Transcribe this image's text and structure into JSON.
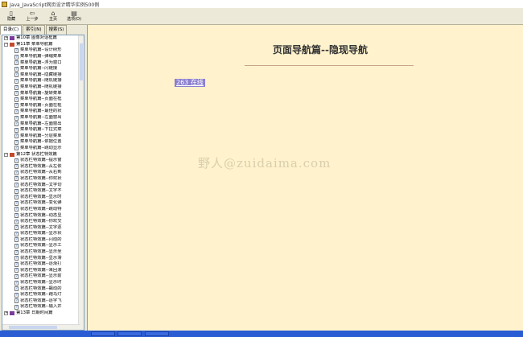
{
  "window": {
    "title": "Java_JavaScript网页设计精华实例500例"
  },
  "toolbar": [
    {
      "icon": "hide-icon",
      "glyph": "▯",
      "label": "隐藏"
    },
    {
      "icon": "back-icon",
      "glyph": "⇦",
      "label": "上一步"
    },
    {
      "icon": "home-icon",
      "glyph": "⌂",
      "label": "主页"
    },
    {
      "icon": "options-icon",
      "glyph": "▤",
      "label": "选项(O)"
    }
  ],
  "tabs": [
    {
      "label": "目录(C)",
      "active": true
    },
    {
      "label": "索引(N)",
      "active": false
    },
    {
      "label": "搜索(S)",
      "active": false
    }
  ],
  "tree": [
    {
      "type": "chapter",
      "expanded": false,
      "label": "第10章 图像对话框篇"
    },
    {
      "type": "chapter",
      "expanded": true,
      "label": "第11章 菜单导航篇"
    },
    {
      "type": "page",
      "label": "菜单导航篇--设计树形"
    },
    {
      "type": "page",
      "label": "菜单导航篇--弹缩菜单"
    },
    {
      "type": "page",
      "label": "菜单导航篇--浮为窗口"
    },
    {
      "type": "page",
      "label": "菜单导航篇--闪链接"
    },
    {
      "type": "page",
      "label": "菜单导航篇--隐藏链接"
    },
    {
      "type": "page",
      "label": "菜单导航篇--随机链接"
    },
    {
      "type": "page",
      "label": "菜单导航篇--随机链接"
    },
    {
      "type": "page",
      "label": "菜单导航篇--旋转菜单"
    },
    {
      "type": "page",
      "label": "菜单导航篇--页面在框"
    },
    {
      "type": "page",
      "label": "菜单导航篇--页面在框"
    },
    {
      "type": "page",
      "label": "菜单导航篇--最佳的状"
    },
    {
      "type": "page",
      "label": "菜单导航篇--左面窗出"
    },
    {
      "type": "page",
      "label": "菜单导航篇--左面窗出"
    },
    {
      "type": "page",
      "label": "菜单导航篇--下拉式菜"
    },
    {
      "type": "page",
      "label": "菜单导航篇--分层菜单"
    },
    {
      "type": "page",
      "label": "菜单导航篇--依据位置"
    },
    {
      "type": "page",
      "label": "菜单导航篇--跳动显示"
    },
    {
      "type": "chapter",
      "expanded": true,
      "label": "第12章 状态栏特效篇"
    },
    {
      "type": "page",
      "label": "状态栏特效篇--提示窗"
    },
    {
      "type": "page",
      "label": "状态栏特效篇--从左依"
    },
    {
      "type": "page",
      "label": "状态栏特效篇--从右到"
    },
    {
      "type": "page",
      "label": "状态栏特效篇--你欢状"
    },
    {
      "type": "page",
      "label": "状态栏特效篇--文字切"
    },
    {
      "type": "page",
      "label": "状态栏特效篇--文字不"
    },
    {
      "type": "page",
      "label": "状态栏特效篇--显示时"
    },
    {
      "type": "page",
      "label": "状态栏特效篇--变化弹"
    },
    {
      "type": "page",
      "label": "状态栏特效篇--跳动特"
    },
    {
      "type": "page",
      "label": "状态栏特效篇--动态显"
    },
    {
      "type": "page",
      "label": "状态栏特效篇--你欢交"
    },
    {
      "type": "page",
      "label": "状态栏特效篇--文字逐"
    },
    {
      "type": "page",
      "label": "状态栏特效篇--显示状"
    },
    {
      "type": "page",
      "label": "状态栏特效篇--闪动的"
    },
    {
      "type": "page",
      "label": "状态栏特效篇--显示工"
    },
    {
      "type": "page",
      "label": "状态栏特效篇--显示坐"
    },
    {
      "type": "page",
      "label": "状态栏特效篇--显示滑"
    },
    {
      "type": "page",
      "label": "状态栏特效篇--逐渐打"
    },
    {
      "type": "page",
      "label": "状态栏特效篇--来回滚"
    },
    {
      "type": "page",
      "label": "状态栏特效篇--显示前"
    },
    {
      "type": "page",
      "label": "状态栏特效篇--显示时"
    },
    {
      "type": "page",
      "label": "状态栏特效篇--飘动的"
    },
    {
      "type": "page",
      "label": "状态栏特效篇--跑马灯"
    },
    {
      "type": "page",
      "label": "状态栏特效篇--逐字飞"
    },
    {
      "type": "page",
      "label": "状态栏特效篇--输入并"
    },
    {
      "type": "chapter",
      "expanded": false,
      "label": "第13章 日期时间篇"
    }
  ],
  "content": {
    "heading": "页面导航篇--隐现导航",
    "example_link": "263 在线",
    "watermark": "野人@zuidaima.com"
  }
}
